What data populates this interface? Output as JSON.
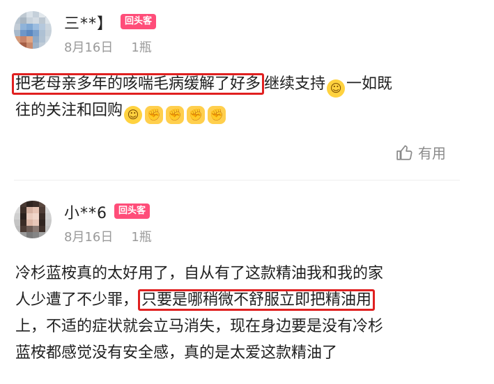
{
  "reviews": [
    {
      "username": "三**】",
      "badge": "回头客",
      "date": "8月16日",
      "quantity": "1瓶",
      "highlight": "把老母亲多年的咳喘毛病缓解了好多",
      "after_highlight": "继续支持",
      "line2": "一如既",
      "line3": "往的关注和回购",
      "useful_label": "有用"
    },
    {
      "username": "小**6",
      "badge": "回头客",
      "date": "8月16日",
      "quantity": "1瓶",
      "line1": "冷杉蓝桉真的太好用了，自从有了这款精油我和我的家",
      "line2_before": "人少遭了不少罪，",
      "highlight": "只要是哪稍微不舒服立即把精油用",
      "line3": "上，不适的症状就会立马消失，现在身边要是没有冷杉",
      "line4": "蓝桉都感觉没有安全感，真的是太爱这款精油了"
    }
  ],
  "icons": [
    "thumbs-up-icon",
    "grin-emoji-icon",
    "fist-emoji-icon"
  ],
  "colors": {
    "badge": "#ff4d79",
    "highlight_border": "#e02020",
    "meta": "#9a9a9a"
  }
}
